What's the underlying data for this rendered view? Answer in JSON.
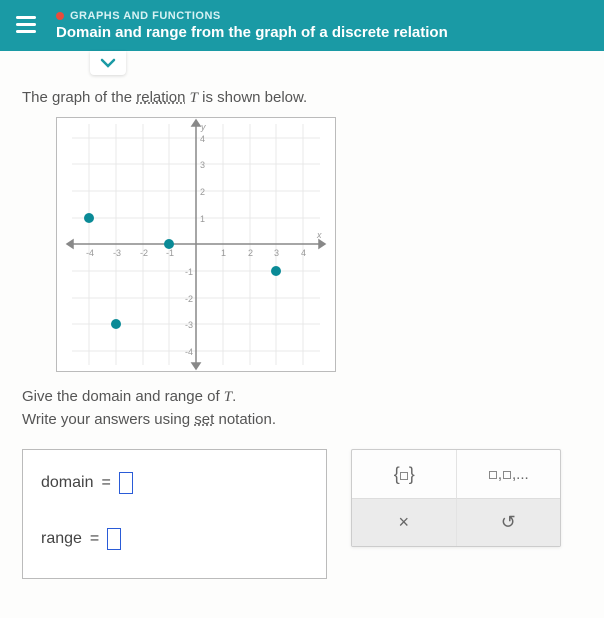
{
  "header": {
    "category": "GRAPHS AND FUNCTIONS",
    "title": "Domain and range from the graph of a discrete relation"
  },
  "prompt": {
    "pre": "The graph of the ",
    "relation_word": "relation",
    "post_pre": " ",
    "var": "T",
    "post": " is shown below."
  },
  "instructions": {
    "line1_pre": "Give the domain and range of ",
    "line1_var": "T",
    "line1_post": ".",
    "line2_pre": "Write your answers using ",
    "line2_set": "set",
    "line2_post": " notation."
  },
  "answers": {
    "domain_label": "domain",
    "range_label": "range",
    "equals": "="
  },
  "toolbox": {
    "set_braces": "{□}",
    "list": "□,□,...",
    "clear": "×",
    "undo": "↺"
  },
  "chart_data": {
    "type": "scatter",
    "title": "",
    "xlabel": "x",
    "ylabel": "y",
    "xlim": [
      -4.5,
      4.5
    ],
    "ylim": [
      -4.5,
      4.5
    ],
    "x_ticks": [
      -4,
      -3,
      -2,
      -1,
      1,
      2,
      3,
      4
    ],
    "y_ticks": [
      -4,
      -3,
      -2,
      -1,
      1,
      2,
      3,
      4
    ],
    "points": [
      {
        "x": -4,
        "y": 1
      },
      {
        "x": -3,
        "y": -3
      },
      {
        "x": -1,
        "y": 0
      },
      {
        "x": 3,
        "y": -1
      }
    ]
  }
}
